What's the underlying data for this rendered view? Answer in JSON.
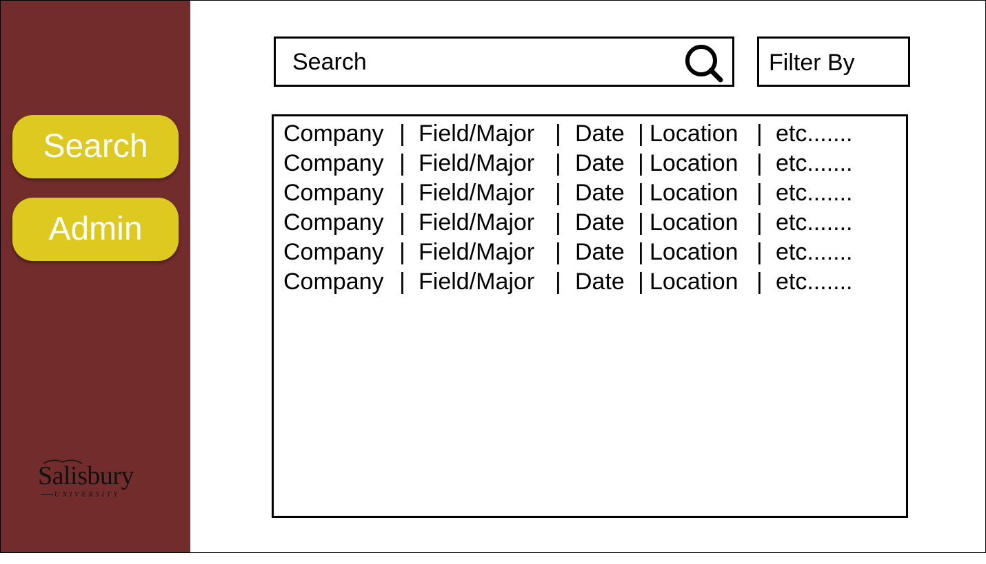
{
  "sidebar": {
    "items": [
      {
        "label": "Search"
      },
      {
        "label": "Admin"
      }
    ],
    "logo": {
      "name": "Salisbury",
      "subtitle": "UNIVERSITY"
    }
  },
  "search": {
    "placeholder": "Search",
    "icon": "search-icon"
  },
  "filter": {
    "label": "Filter By"
  },
  "results": {
    "separator": "|",
    "rows": [
      [
        "Company",
        "Field/Major",
        "Date",
        "Location",
        "etc......."
      ],
      [
        "Company",
        "Field/Major",
        "Date",
        "Location",
        "etc......."
      ],
      [
        "Company",
        "Field/Major",
        "Date",
        "Location",
        "etc......."
      ],
      [
        "Company",
        "Field/Major",
        "Date",
        "Location",
        "etc......."
      ],
      [
        "Company",
        "Field/Major",
        "Date",
        "Location",
        "etc......."
      ],
      [
        "Company",
        "Field/Major",
        "Date",
        "Location",
        "etc......."
      ]
    ]
  },
  "colors": {
    "sidebar": "#722c2c",
    "button": "#dec921",
    "button_text": "#ffffff",
    "border": "#000000"
  }
}
